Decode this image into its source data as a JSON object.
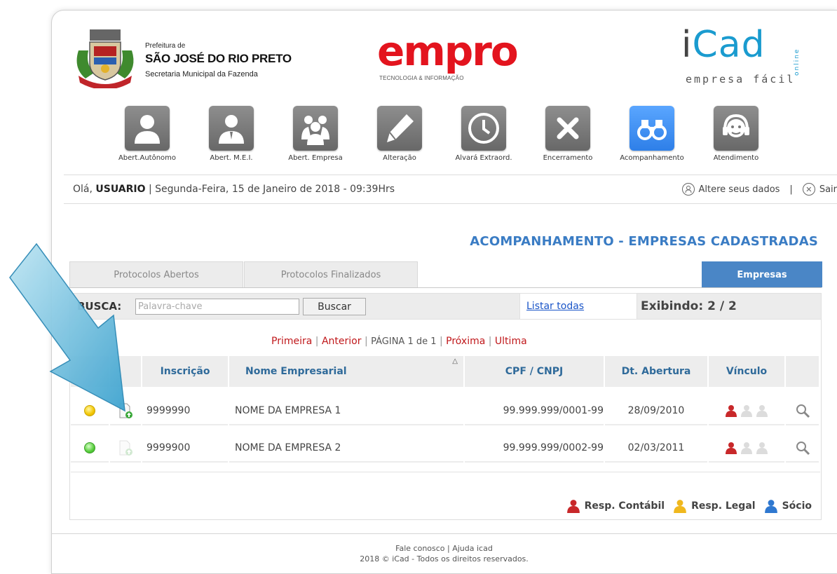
{
  "header": {
    "prefeitura_small": "Prefeitura de",
    "prefeitura_name": "SÃO JOSÉ DO RIO PRETO",
    "prefeitura_sub": "Secretaria Municipal da Fazenda",
    "empro_word": "empro",
    "empro_sub": "TECNOLOGIA & INFORMAÇÃO",
    "icad_i": "i",
    "icad_rest": "Cad",
    "icad_sub": "empresa fácil",
    "icad_online": "online"
  },
  "nav": [
    {
      "label": "Abert.Autônomo",
      "icon": "person-icon"
    },
    {
      "label": "Abert. M.E.I.",
      "icon": "businessman-icon"
    },
    {
      "label": "Abert. Empresa",
      "icon": "group-icon"
    },
    {
      "label": "Alteração",
      "icon": "pencil-icon"
    },
    {
      "label": "Alvará Extraord.",
      "icon": "clock-icon"
    },
    {
      "label": "Encerramento",
      "icon": "close-icon"
    },
    {
      "label": "Acompanhamento",
      "icon": "binoculars-icon"
    },
    {
      "label": "Atendimento",
      "icon": "headset-icon"
    }
  ],
  "greeting": {
    "prefix": "Olá,",
    "user": "USUARIO",
    "date": "| Segunda-Feira, 15 de Janeiro de 2018 - 09:39Hrs",
    "alter_data": "Altere seus dados",
    "separator": "|",
    "logout": "Sair"
  },
  "section_title": "ACOMPANHAMENTO - EMPRESAS CADASTRADAS",
  "tabs": [
    {
      "label": "Protocolos Abertos",
      "active": false
    },
    {
      "label": "Protocolos Finalizados",
      "active": false
    },
    {
      "label": "Empresas",
      "active": true
    }
  ],
  "search": {
    "label": "BUSCA:",
    "placeholder": "Palavra-chave",
    "button": "Buscar",
    "list_all": "Listar todas",
    "showing": "Exibindo: 2 / 2"
  },
  "pager": {
    "first": "Primeira",
    "prev": "Anterior",
    "page": "PÁGINA 1 de 1",
    "next": "Próxima",
    "last": "Ultima",
    "sep": "|"
  },
  "table": {
    "headers": [
      "Inscrição",
      "Nome Empresarial",
      "CPF / CNPJ",
      "Dt. Abertura",
      "Vínculo"
    ],
    "rows": [
      {
        "status": "yellow",
        "inscricao": "9999990",
        "nome": "NOME DA EMPRESA 1",
        "cnpj": "99.999.999/0001-99",
        "abertura": "28/09/2010"
      },
      {
        "status": "green",
        "inscricao": "9999900",
        "nome": "NOME DA EMPRESA 2",
        "cnpj": "99.999.999/0002-99",
        "abertura": "02/03/2011"
      }
    ]
  },
  "legend": {
    "contabil": "Resp. Contábil",
    "legal": "Resp. Legal",
    "socio": "Sócio",
    "colors": {
      "contabil": "#c8282a",
      "legal": "#f0b81e",
      "socio": "#2f78d0"
    }
  },
  "footer": {
    "line1": "Fale conosco | Ajuda icad",
    "line2": "2018 © iCad - Todos os direitos reservados."
  },
  "colors": {
    "accent_blue": "#3a7cc4",
    "active_tab": "#4a86c6",
    "pager_link": "#c0181b",
    "arrow": "#5ab4d8"
  }
}
